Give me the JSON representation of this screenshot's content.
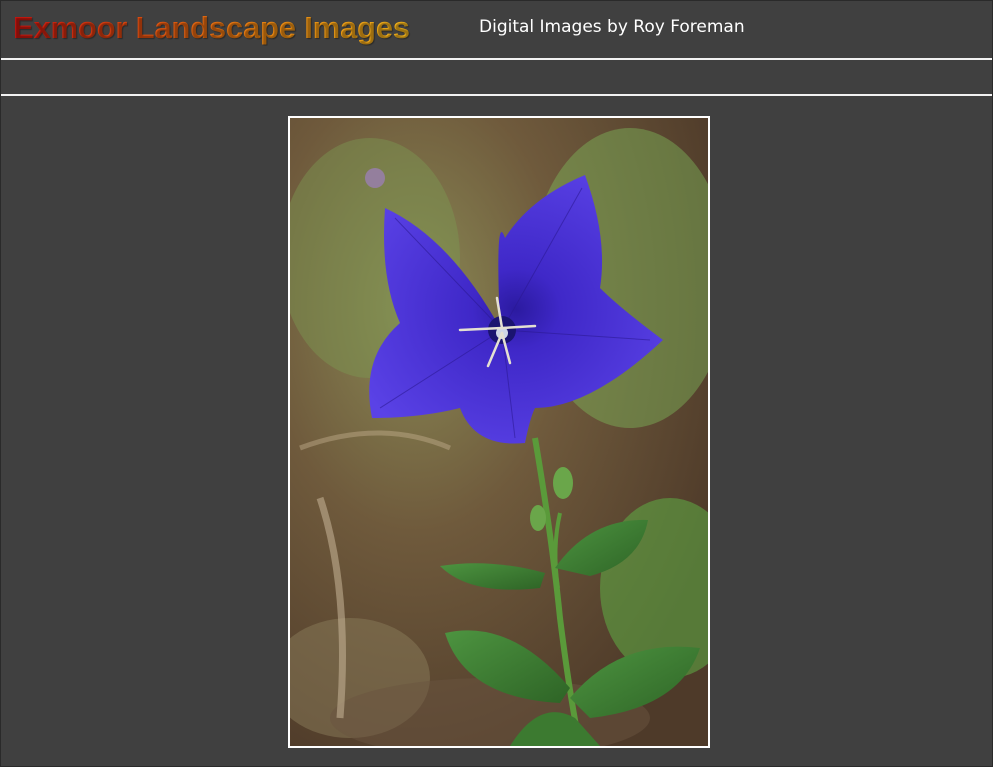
{
  "header": {
    "site_title": "Exmoor Landscape Images",
    "subtitle": "Digital Images by Roy Foreman"
  },
  "nav": {
    "items": []
  },
  "main": {
    "photo": {
      "subject": "blue-balloon-flower-photo"
    }
  },
  "colors": {
    "background": "#404040",
    "rule": "#f2f2f2",
    "title_gradient_start": "#c8140f",
    "title_gradient_end": "#f2b51c",
    "flower_petal": "#4a30d8",
    "leaf": "#3e7d33"
  }
}
